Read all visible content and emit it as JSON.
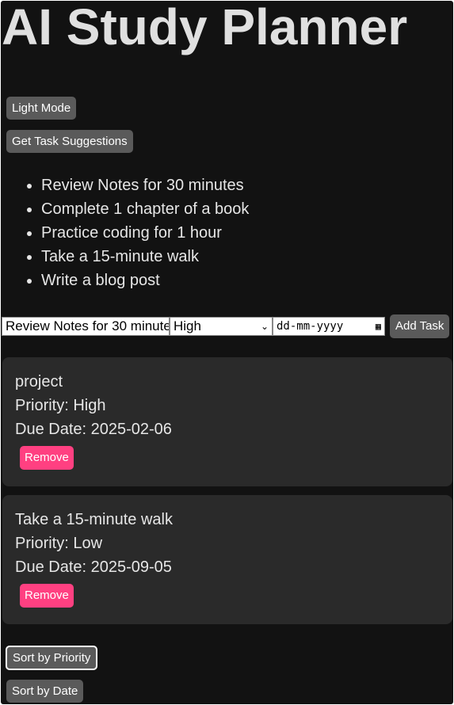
{
  "title": "AI Study Planner",
  "theme_button": "Light Mode",
  "suggest_button": "Get Task Suggestions",
  "suggestions": [
    "Review Notes for 30 minutes",
    "Complete 1 chapter of a book",
    "Practice coding for 1 hour",
    "Take a 15-minute walk",
    "Write a blog post"
  ],
  "form": {
    "task_value": "Review Notes for 30 minute",
    "priority_selected": "High",
    "date_placeholder": "dd-mm-yyyy",
    "add_button": "Add Task"
  },
  "tasks": [
    {
      "name": "project",
      "priority": "Priority: High",
      "due": "Due Date: 2025-02-06",
      "remove": "Remove"
    },
    {
      "name": "Take a 15-minute walk",
      "priority": "Priority: Low",
      "due": "Due Date: 2025-09-05",
      "remove": "Remove"
    }
  ],
  "sort_priority": "Sort by Priority",
  "sort_date": "Sort by Date"
}
